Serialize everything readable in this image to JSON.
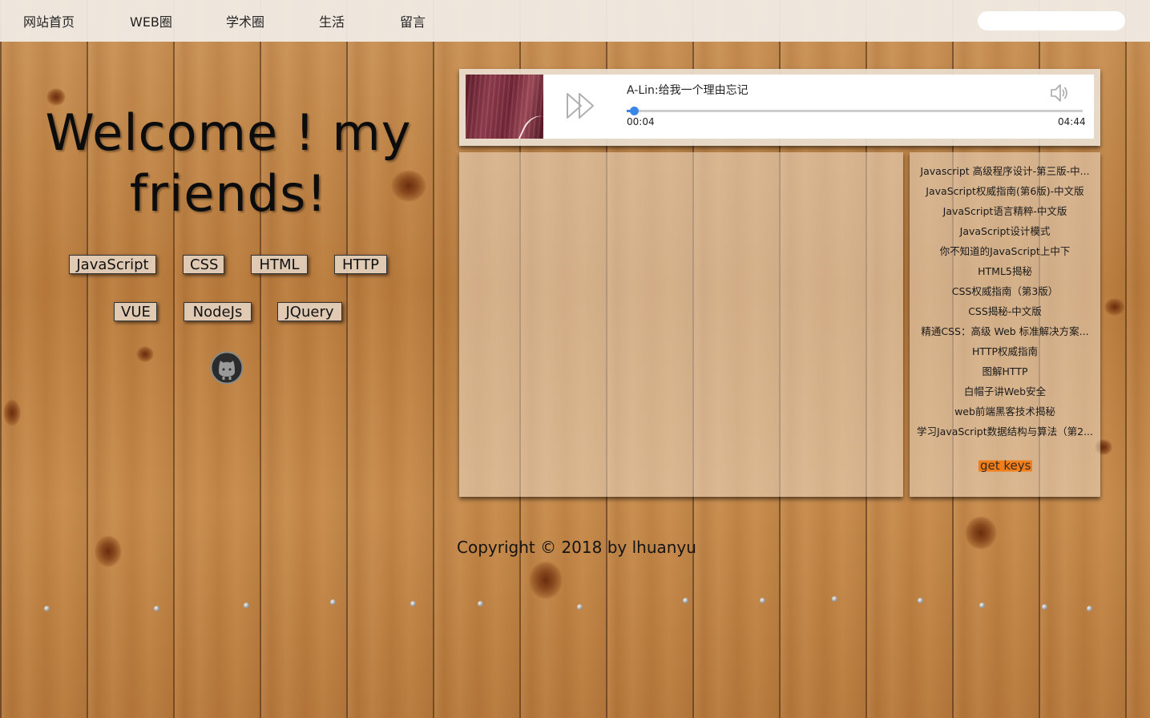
{
  "nav": {
    "items": [
      "网站首页",
      "WEB圈",
      "学术圈",
      "生活",
      "留言"
    ],
    "search_value": ""
  },
  "hero": {
    "title_line1": "Welcome ! my",
    "title_line2": "friends!",
    "tags_row1": [
      "JavaScript",
      "CSS",
      "HTML",
      "HTTP"
    ],
    "tags_row2": [
      "VUE",
      "NodeJs",
      "JQuery"
    ],
    "github_icon": "github-icon"
  },
  "player": {
    "song": "A-Lin:给我一个理由忘记",
    "current_time": "00:04",
    "total_time": "04:44",
    "progress": 0.015,
    "play_icon": "play-icon",
    "volume_icon": "volume-icon"
  },
  "books": {
    "items": [
      "Javascript 高级程序设计-第三版-中...",
      "JavaScript权威指南(第6版)-中文版",
      "JavaScript语言精粹-中文版",
      "JavaScript设计模式",
      "你不知道的JavaScript上中下",
      "HTML5揭秘",
      "CSS权威指南（第3版）",
      "CSS揭秘-中文版",
      "精通CSS：高级 Web 标准解决方案...",
      "HTTP权威指南",
      "图解HTTP",
      "白帽子讲Web安全",
      "web前端黑客技术揭秘",
      "学习JavaScript数据结构与算法（第2..."
    ],
    "get_keys": "get keys"
  },
  "footer": {
    "copyright": "Copyright © 2018 by lhuanyu"
  },
  "colors": {
    "accent": "#3a86e8",
    "highlight": "#f07e1c"
  }
}
